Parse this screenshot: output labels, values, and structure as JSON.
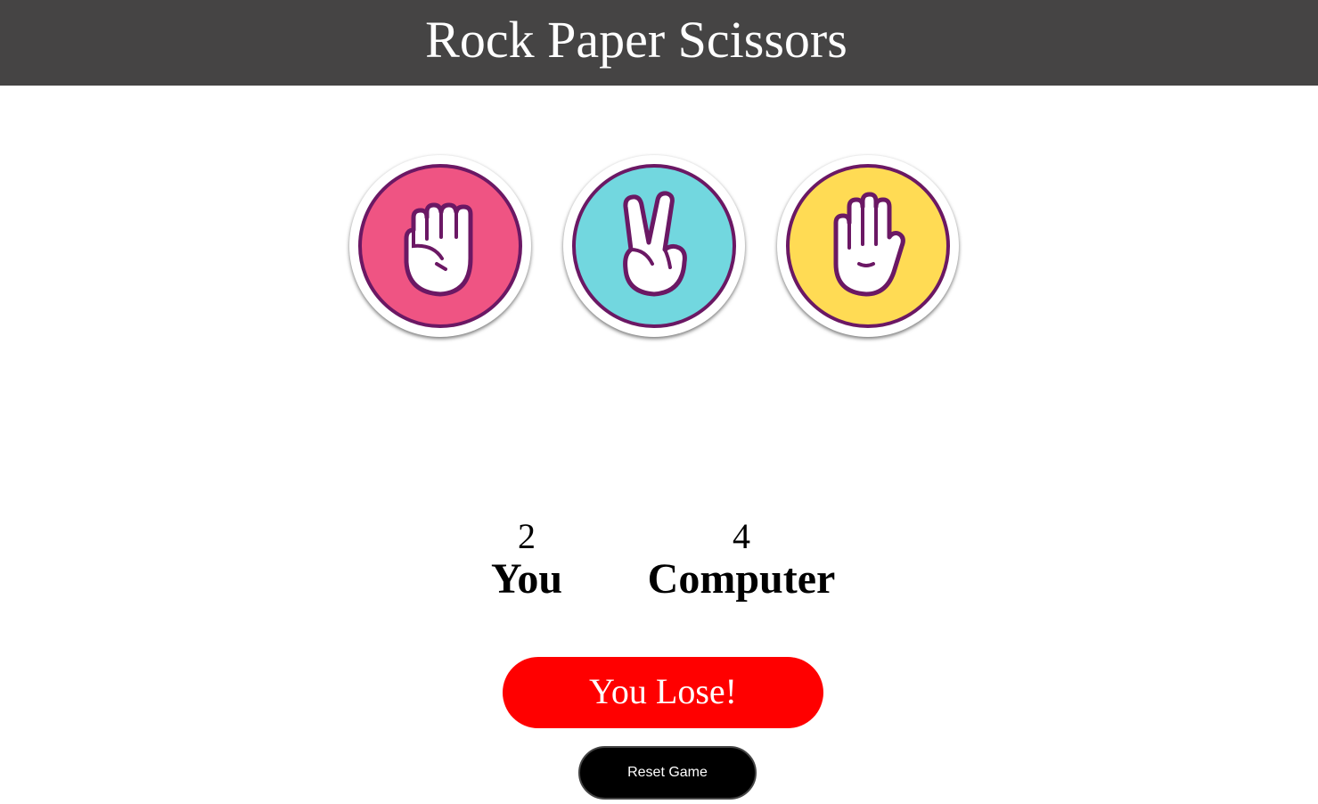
{
  "header": {
    "title": "Rock Paper Scissors",
    "background_color": "#454444"
  },
  "choices": [
    {
      "id": "rock",
      "icon": "fist-icon",
      "color": "#ef5483"
    },
    {
      "id": "scissors",
      "icon": "peace-sign-icon",
      "color": "#72d7df"
    },
    {
      "id": "paper",
      "icon": "open-hand-icon",
      "color": "#ffdb54"
    }
  ],
  "scores": {
    "user": {
      "value": "2",
      "label": "You"
    },
    "computer": {
      "value": "4",
      "label": "Computer"
    }
  },
  "result": {
    "text": "You Lose!",
    "color": "#ff0000"
  },
  "reset": {
    "label": "Reset Game",
    "color": "#000000"
  }
}
